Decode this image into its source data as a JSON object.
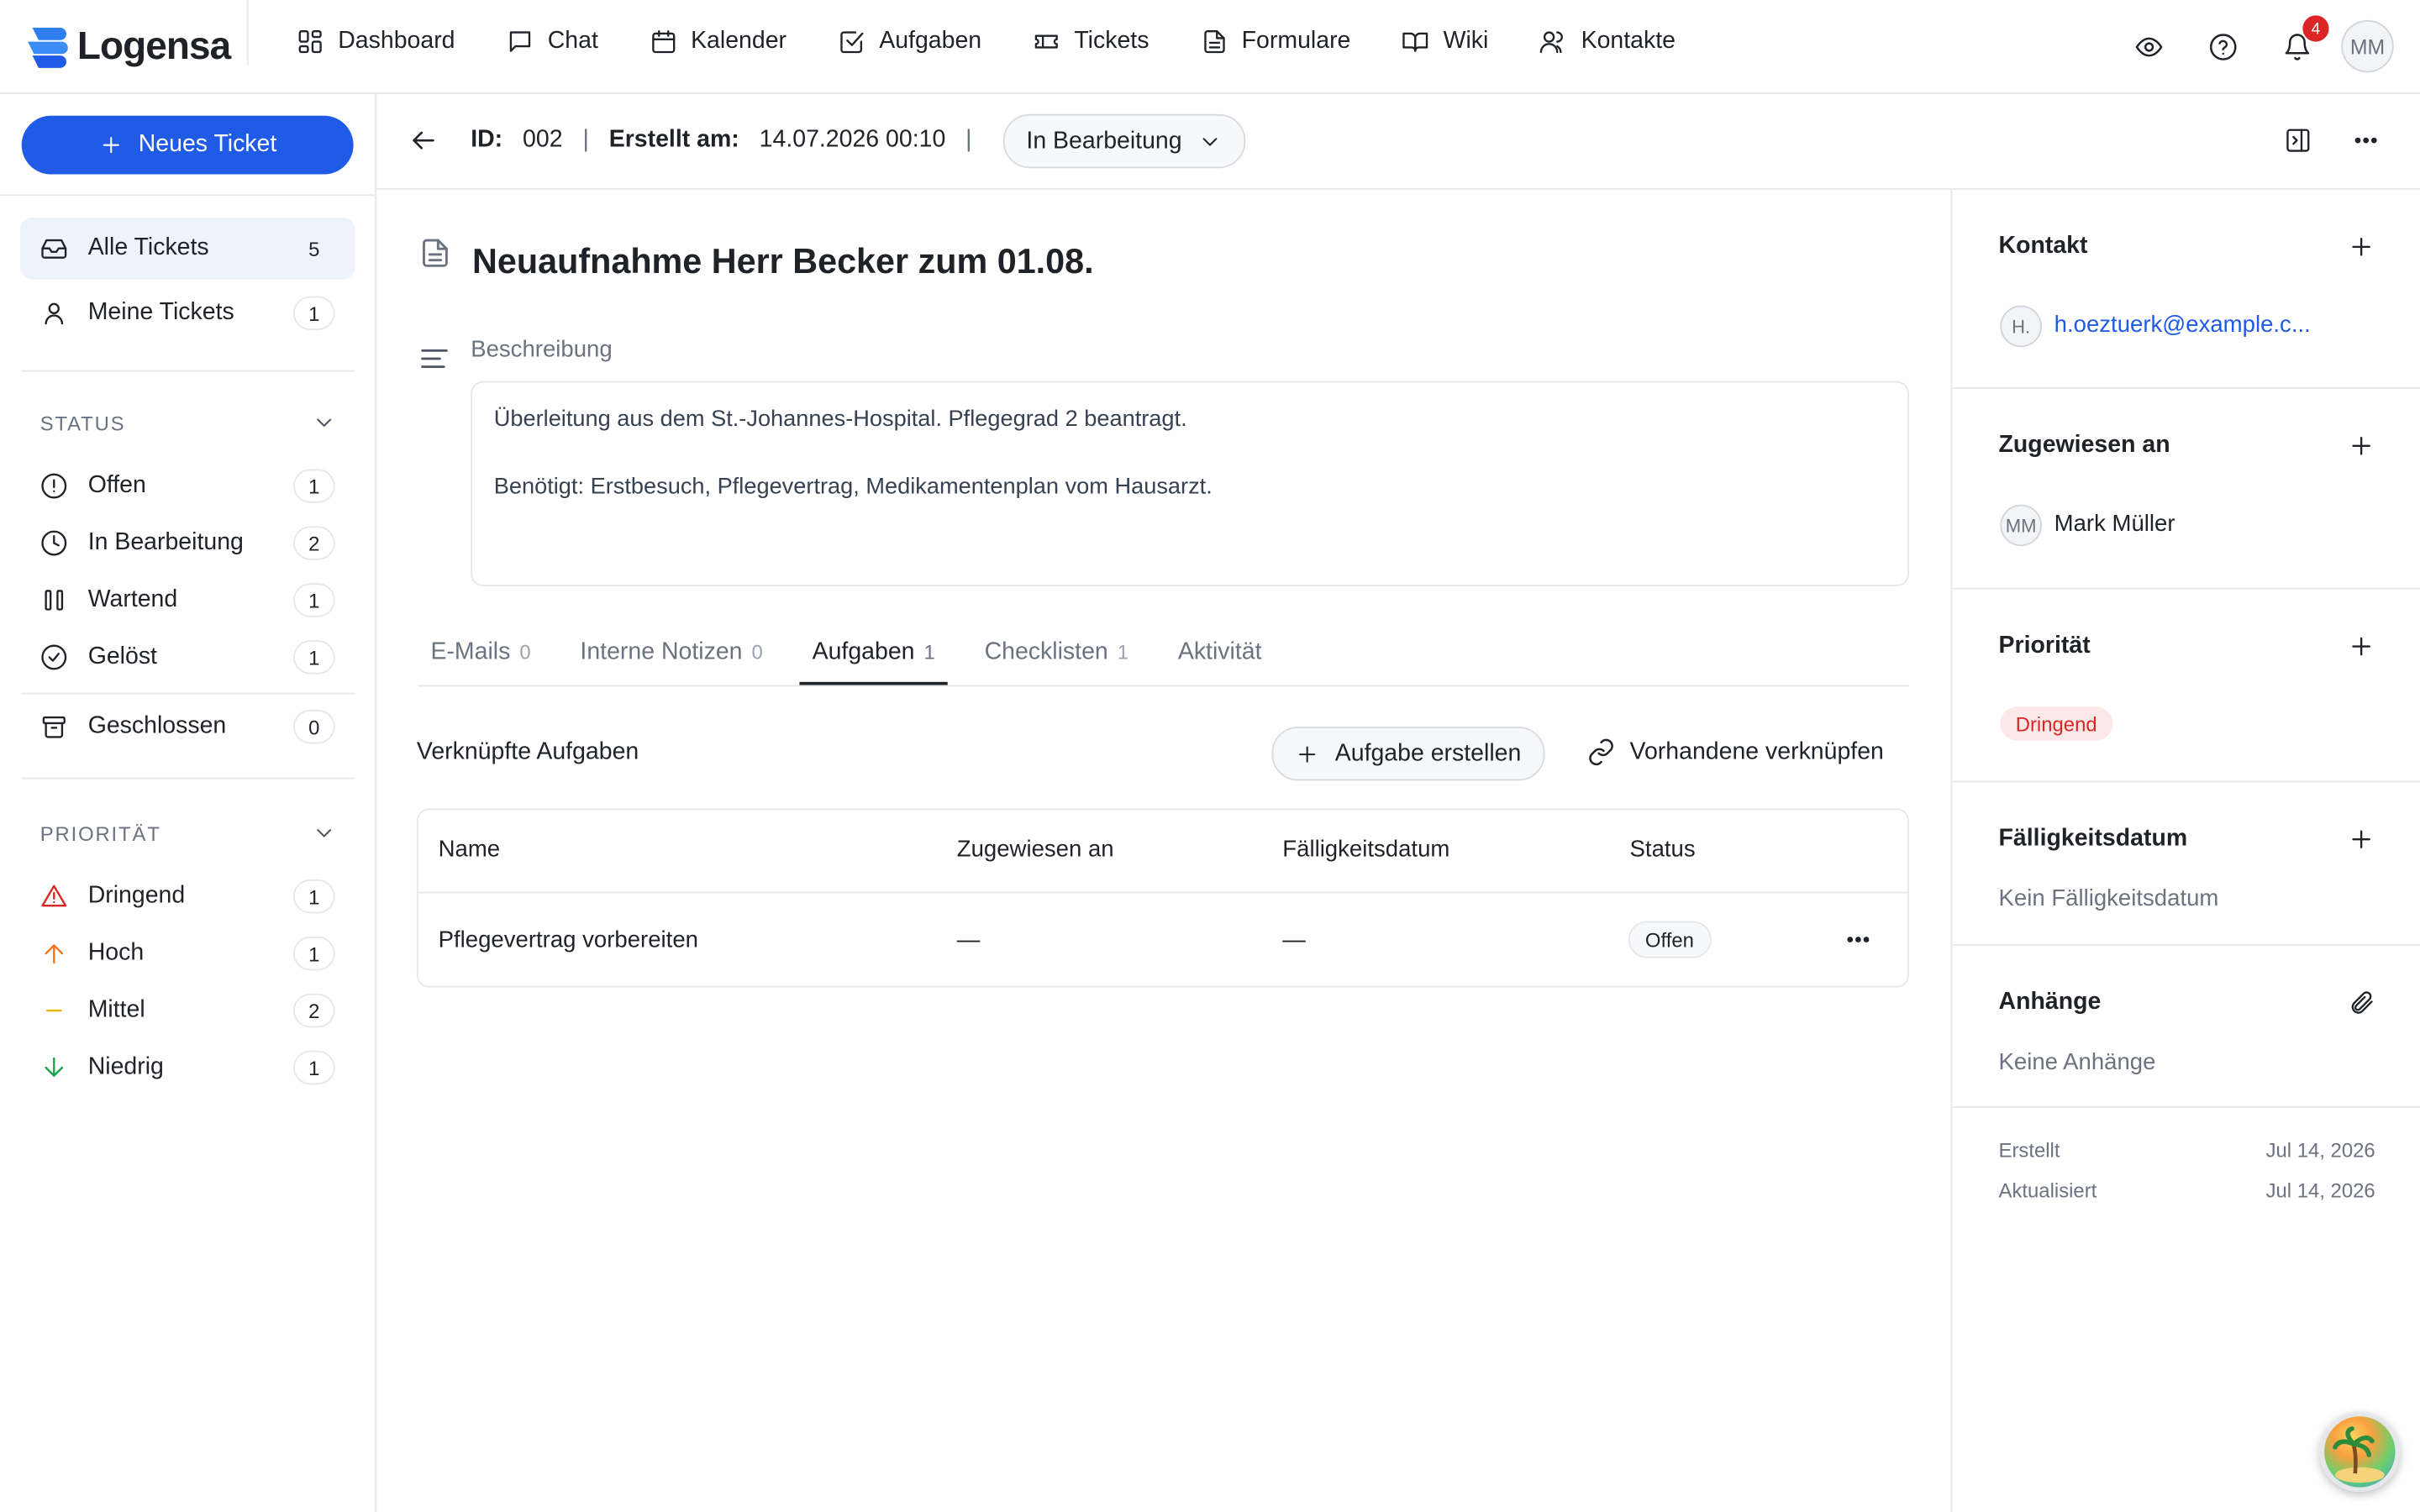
{
  "brand": {
    "name": "Logensa",
    "accent": "#1f5be6"
  },
  "nav": {
    "items": [
      {
        "label": "Dashboard",
        "icon": "dashboard-icon"
      },
      {
        "label": "Chat",
        "icon": "chat-icon"
      },
      {
        "label": "Kalender",
        "icon": "calendar-icon"
      },
      {
        "label": "Aufgaben",
        "icon": "checkbox-icon"
      },
      {
        "label": "Tickets",
        "icon": "ticket-icon"
      },
      {
        "label": "Formulare",
        "icon": "document-icon"
      },
      {
        "label": "Wiki",
        "icon": "book-icon"
      },
      {
        "label": "Kontakte",
        "icon": "contacts-icon"
      }
    ],
    "notification_count": "4",
    "user_initials": "MM"
  },
  "sidebar": {
    "new_ticket_label": "Neues Ticket",
    "views": [
      {
        "label": "Alle Tickets",
        "count": "5"
      },
      {
        "label": "Meine Tickets",
        "count": "1"
      }
    ],
    "status_heading": "STATUS",
    "status_items": [
      {
        "label": "Offen",
        "count": "1"
      },
      {
        "label": "In Bearbeitung",
        "count": "2"
      },
      {
        "label": "Wartend",
        "count": "1"
      },
      {
        "label": "Gelöst",
        "count": "1"
      },
      {
        "label": "Geschlossen",
        "count": "0"
      }
    ],
    "priority_heading": "PRIORITÄT",
    "priority_items": [
      {
        "label": "Dringend",
        "count": "1",
        "color": "#dc2626"
      },
      {
        "label": "Hoch",
        "count": "1",
        "color": "#f97316"
      },
      {
        "label": "Mittel",
        "count": "2",
        "color": "#eab308"
      },
      {
        "label": "Niedrig",
        "count": "1",
        "color": "#16a34a"
      }
    ]
  },
  "ticket": {
    "id_label": "ID:",
    "id": "002",
    "created_label": "Erstellt am:",
    "created": "14.07.2026 00:10",
    "separator": "|",
    "status": "In Bearbeitung",
    "title": "Neuaufnahme Herr Becker zum 01.08.",
    "description_label": "Beschreibung",
    "description_lines": [
      "Überleitung aus dem St.-Johannes-Hospital. Pflegegrad 2 beantragt.",
      "Benötigt: Erstbesuch, Pflegevertrag, Medikamentenplan vom Hausarzt."
    ]
  },
  "tabs": [
    {
      "label": "E-Mails",
      "count": "0"
    },
    {
      "label": "Interne Notizen",
      "count": "0"
    },
    {
      "label": "Aufgaben",
      "count": "1"
    },
    {
      "label": "Checklisten",
      "count": "1"
    },
    {
      "label": "Aktivität",
      "count": ""
    }
  ],
  "tasks": {
    "heading": "Verknüpfte Aufgaben",
    "create_label": "Aufgabe erstellen",
    "link_label": "Vorhandene verknüpfen",
    "columns": [
      "Name",
      "Zugewiesen an",
      "Fälligkeitsdatum",
      "Status"
    ],
    "rows": [
      {
        "name": "Pflegevertrag vorbereiten",
        "assignee": "—",
        "due": "—",
        "status": "Offen"
      }
    ]
  },
  "details": {
    "contact_title": "Kontakt",
    "contact_initial": "H.",
    "contact_email": "h.oeztuerk@example.c...",
    "assigned_title": "Zugewiesen an",
    "assignee_initials": "MM",
    "assignee_name": "Mark Müller",
    "priority_title": "Priorität",
    "priority_value": "Dringend",
    "due_title": "Fälligkeitsdatum",
    "due_value": "Kein Fälligkeitsdatum",
    "attachments_title": "Anhänge",
    "attachments_value": "Keine Anhänge",
    "created_label": "Erstellt",
    "created_value": "Jul 14, 2026",
    "updated_label": "Aktualisiert",
    "updated_value": "Jul 14, 2026"
  }
}
